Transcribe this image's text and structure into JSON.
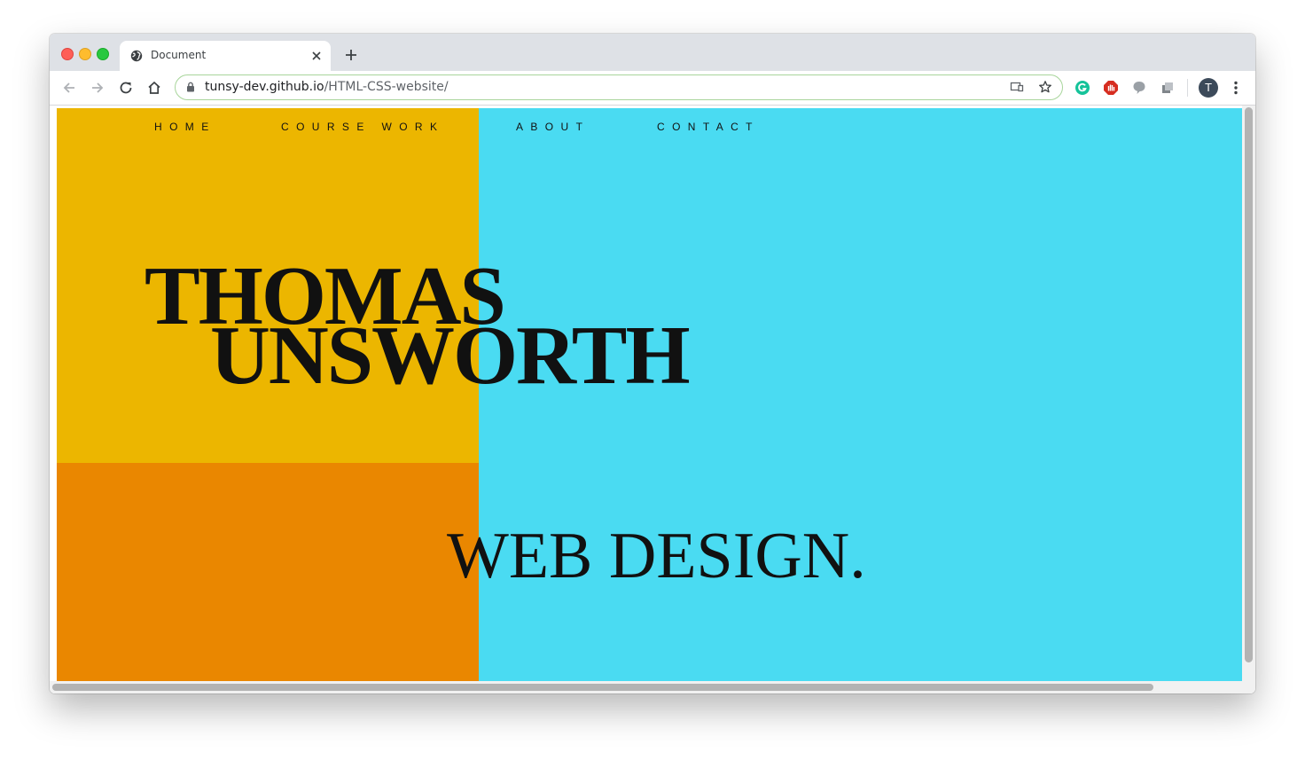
{
  "browser": {
    "tab": {
      "title": "Document",
      "favicon": "globe-icon"
    },
    "omnibox": {
      "host": "tunsy-dev.github.io",
      "path": "/HTML-CSS-website/"
    },
    "profile_initial": "T",
    "icons": [
      "back-icon",
      "forward-icon",
      "reload-icon",
      "home-icon",
      "lock-icon",
      "cast-icon",
      "star-icon",
      "grammarly-icon",
      "adblock-icon",
      "speech-icon",
      "extension-icon",
      "menu-icon"
    ],
    "colors": {
      "tabstrip": "#dee1e6",
      "omnibox_border": "#a8d59b"
    }
  },
  "site": {
    "nav": [
      {
        "label": "HOME"
      },
      {
        "label": "COURSE WORK"
      },
      {
        "label": "ABOUT"
      },
      {
        "label": "CONTACT"
      }
    ],
    "hero": {
      "line1": "THOMAS",
      "line2": "UNSWORTH"
    },
    "tagline": "WEB DESIGN.",
    "colors": {
      "yellow": "#ecb600",
      "orange": "#ea8700",
      "cyan": "#4adbf2",
      "text": "#111111"
    }
  }
}
